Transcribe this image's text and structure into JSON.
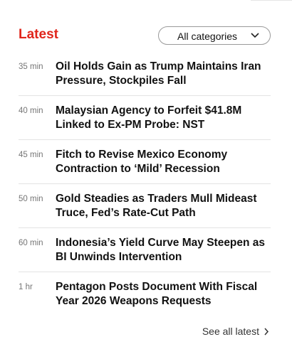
{
  "section": {
    "title": "Latest",
    "filter_label": "All categories",
    "see_all_label": "See all latest"
  },
  "items": [
    {
      "time": "35 min",
      "headline": "Oil Holds Gain as Trump Maintains Iran Pressure, Stockpiles Fall"
    },
    {
      "time": "40 min",
      "headline": "Malaysian Agency to Forfeit $41.8M Linked to Ex-PM Probe: NST"
    },
    {
      "time": "45 min",
      "headline": "Fitch to Revise Mexico Economy Contraction to ‘Mild’ Recession"
    },
    {
      "time": "50 min",
      "headline": "Gold Steadies as Traders Mull Mideast Truce, Fed’s Rate-Cut Path"
    },
    {
      "time": "60 min",
      "headline": "Indonesia’s Yield Curve May Steepen as BI Unwinds Intervention"
    },
    {
      "time": "1 hr",
      "headline": "Pentagon Posts Document With Fiscal Year 2026 Weapons Requests"
    }
  ],
  "colors": {
    "accent": "#e0251b",
    "timestamp": "#757575",
    "divider": "#e3e3e3"
  },
  "icons": {
    "filter": "chevron-down-icon",
    "see_all": "chevron-right-icon"
  }
}
